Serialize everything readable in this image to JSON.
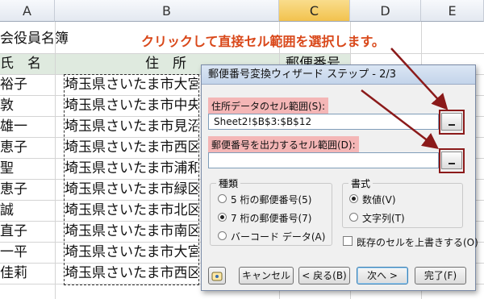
{
  "sheet": {
    "columns": [
      "A",
      "B",
      "C",
      "D",
      "E"
    ],
    "title": "会役員名簿",
    "header_name": "氏　名",
    "header_address": "住　所",
    "header_postal": "郵便番号",
    "names": [
      "裕子",
      "敦",
      "雄一",
      "恵子",
      "聖",
      "恵子",
      "誠",
      "直子",
      "一平",
      "佳莉"
    ],
    "addresses": [
      "埼玉県さいたま市大宮",
      "埼玉県さいたま市中央",
      "埼玉県さいたま市見沼",
      "埼玉県さいたま市西区",
      "埼玉県さいたま市浦和",
      "埼玉県さいたま市緑区",
      "埼玉県さいたま市北区",
      "埼玉県さいたま市南区",
      "埼玉県さいたま市大宮",
      "埼玉県さいたま市西区"
    ]
  },
  "annotation": "クリックして直接セル範囲を選択します。",
  "dialog": {
    "title": "郵便番号変換ウィザード ステップ - 2/3",
    "address_range_label": "住所データのセル範囲(S):",
    "address_range_value": "Sheet2!$B$3:$B$12",
    "output_range_label": "郵便番号を出力するセル範囲(D):",
    "output_range_value": "",
    "kind_group": "種類",
    "kind_options": [
      "5 桁の郵便番号(5)",
      "7 桁の郵便番号(7)",
      "バーコード データ(A)"
    ],
    "format_group": "書式",
    "format_options": [
      "数値(V)",
      "文字列(T)"
    ],
    "overwrite_label": "既存のセルを上書きする(O)",
    "buttons": {
      "cancel": "キャンセル",
      "back": "< 戻る(B)",
      "next": "次へ >",
      "finish": "完了(F)"
    }
  }
}
